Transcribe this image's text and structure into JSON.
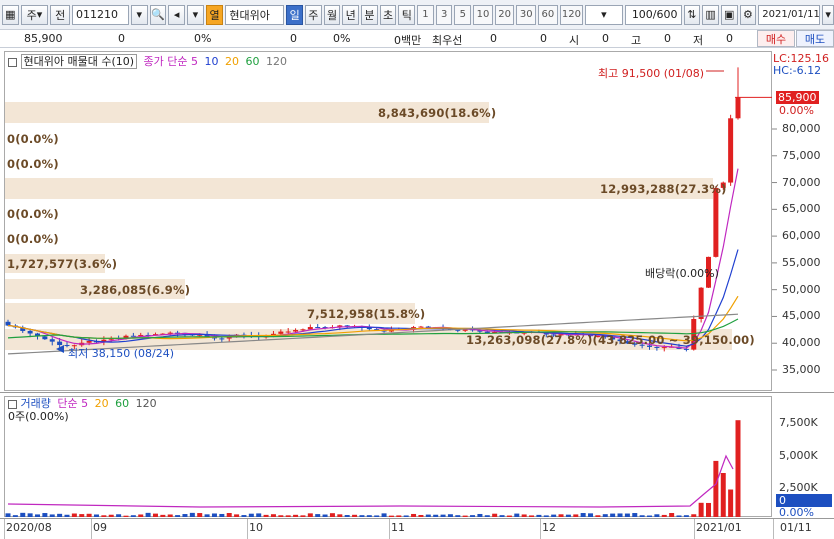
{
  "toolbar": {
    "market": "주",
    "prev": "전",
    "code": "011210",
    "highlight": "열",
    "stock_name": "현대위아",
    "periods_main": [
      "일",
      "주",
      "월",
      "년",
      "분",
      "초",
      "틱"
    ],
    "periods_num": [
      "1",
      "3",
      "5",
      "10",
      "20",
      "30",
      "60",
      "120"
    ],
    "count": "100/600",
    "date": "2021/01/11"
  },
  "infobar": {
    "price": "85,900",
    "v1": "0",
    "v2": "0%",
    "v3": "0",
    "v4": "0%",
    "v5": "0백만",
    "label_priority": "최우선",
    "v6": "0",
    "v7": "0",
    "label_open": "시",
    "v8": "0",
    "label_high": "고",
    "v9": "0",
    "label_low": "저",
    "v10": "0",
    "buy": "매수",
    "sell": "매도"
  },
  "main_chart": {
    "legend_name": "현대위아 매물대 수(10)",
    "legend_ma": "종가 단순",
    "ma_periods": [
      "5",
      "10",
      "20",
      "60",
      "120"
    ],
    "ma_colors": [
      "#c028c0",
      "#2040d0",
      "#f0a000",
      "#20a040",
      "#777777"
    ],
    "lc": "LC:125.16",
    "hc": "HC:-6.12",
    "current_price": "85,900",
    "current_pct": "0.00%",
    "y_ticks": [
      "80,000",
      "75,000",
      "70,000",
      "65,000",
      "60,000",
      "55,000",
      "50,000",
      "45,000",
      "40,000",
      "35,000"
    ],
    "band_labels": [
      "8,843,690(18.6%)",
      "0(0.0%)",
      "0(0.0%)",
      "12,993,288(27.3%)",
      "0(0.0%)",
      "0(0.0%)",
      "1,727,577(3.6%)",
      "3,286,085(6.9%)",
      "7,512,958(15.8%)",
      "13,263,098(27.8%)(43,825.00 ~ 39,150.00)"
    ],
    "high_note": "최고 91,500 (01/08)",
    "low_note": "최저 38,150 (08/24)",
    "dividend_note": "배당락(0.00%)"
  },
  "volume_chart": {
    "legend_name": "거래량",
    "legend_ma": "단순",
    "ma_periods": [
      "5",
      "20",
      "60",
      "120"
    ],
    "ma_colors": [
      "#c028c0",
      "#f0a000",
      "#20a040",
      "#555555"
    ],
    "current_text": "0주(0.00%)",
    "y_ticks": [
      "7,500K",
      "5,000K",
      "2,500K"
    ],
    "current_value": "0",
    "current_pct": "0.00%"
  },
  "x_axis": {
    "ticks": [
      "2020/08",
      "09",
      "10",
      "11",
      "12",
      "2021/01"
    ],
    "right_date": "01/11"
  },
  "chart_data": {
    "type": "candlestick",
    "ylim": [
      30000,
      95000
    ],
    "high": 91500,
    "low": 38150,
    "last_close": 85900,
    "volume_ylim": [
      0,
      10000000
    ]
  }
}
